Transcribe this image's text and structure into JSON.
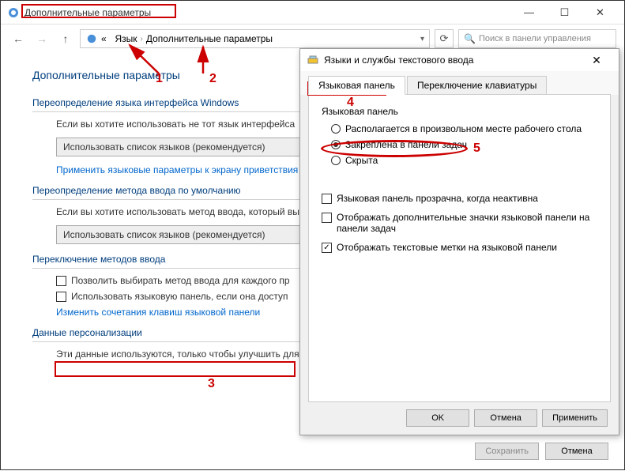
{
  "window": {
    "title": "Дополнительные параметры",
    "min_icon": "—",
    "max_icon": "☐",
    "close_icon": "✕"
  },
  "nav": {
    "back_icon": "←",
    "forward_icon": "→",
    "up_icon": "↑",
    "refresh_icon": "⟳"
  },
  "breadcrumb": {
    "root_icon": "«",
    "item1": "Язык",
    "item2": "Дополнительные параметры",
    "sep": "›",
    "dropdown_glyph": "▾"
  },
  "search": {
    "placeholder": "Поиск в панели управления",
    "icon": "🔍"
  },
  "page": {
    "heading": "Дополнительные параметры",
    "section1_title": "Переопределение языка интерфейса Windows",
    "section1_text": "Если вы хотите использовать не тот язык интерфейса",
    "dropdown1": "Использовать список языков (рекомендуется)",
    "link1": "Применить языковые параметры к экрану приветствия пользователей",
    "section2_title": "Переопределение метода ввода по умолчанию",
    "section2_text": "Если вы хотите использовать метод ввода, который выберите его здесь.",
    "dropdown2": "Использовать список языков (рекомендуется)",
    "section3_title": "Переключение методов ввода",
    "check1": "Позволить выбирать метод ввода для каждого пр",
    "check2": "Использовать языковую панель, если она доступ",
    "link2": "Изменить сочетания клавиш языковой панели",
    "section4_title": "Данные персонализации",
    "section4_text": "Эти данные используются, только чтобы улучшить для языков без IME на этом компьютере. Никакая ин"
  },
  "buttons": {
    "save": "Сохранить",
    "cancel": "Отмена"
  },
  "dialog": {
    "title": "Языки и службы текстового ввода",
    "close_icon": "✕",
    "tabs": {
      "t1": "Языковая панель",
      "t2": "Переключение клавиатуры"
    },
    "group_title": "Языковая панель",
    "radio1": "Располагается в произвольном месте рабочего стола",
    "radio2": "Закреплена в панели задач",
    "radio3": "Скрыта",
    "check1": "Языковая панель прозрачна, когда неактивна",
    "check2": "Отображать дополнительные значки языковой панели на панели задач",
    "check3": "Отображать текстовые метки на языковой панели",
    "ok": "OK",
    "cancel": "Отмена",
    "apply": "Применить"
  },
  "annotations": {
    "n1": "1",
    "n2": "2",
    "n3": "3",
    "n4": "4",
    "n5": "5"
  }
}
